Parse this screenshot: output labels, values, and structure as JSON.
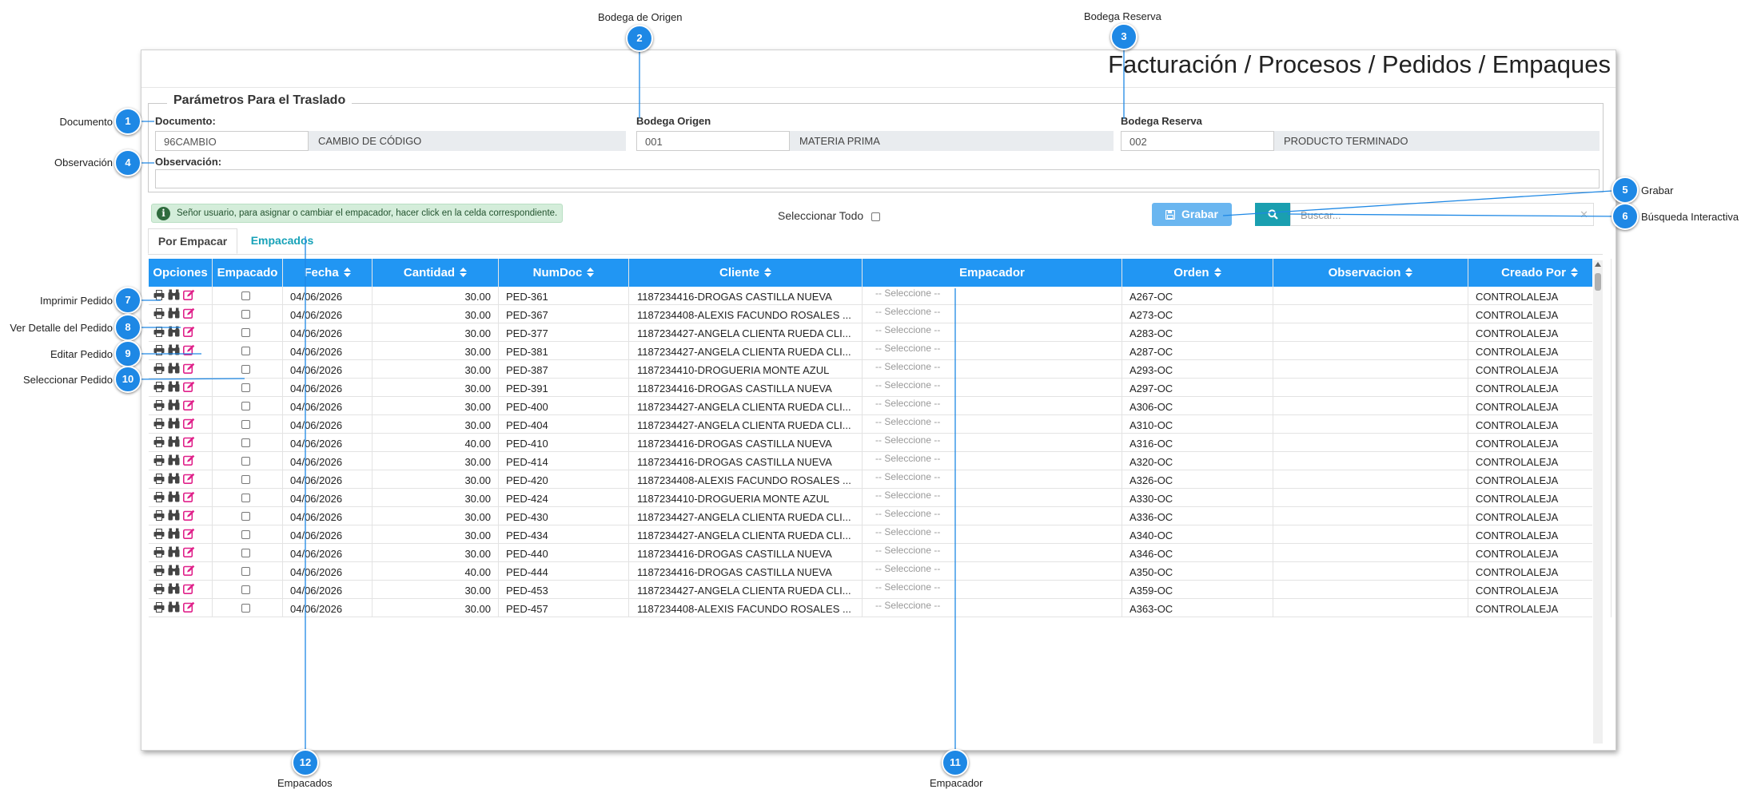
{
  "page_title": "Facturación / Procesos / Pedidos / Empaques",
  "params": {
    "legend": "Parámetros Para el Traslado",
    "documento_label": "Documento:",
    "documento_code": "96CAMBIO",
    "documento_desc": "CAMBIO DE CÓDIGO",
    "origen_label": "Bodega Origen",
    "origen_code": "001",
    "origen_desc": "MATERIA PRIMA",
    "reserva_label": "Bodega Reserva",
    "reserva_code": "002",
    "reserva_desc": "PRODUCTO TERMINADO",
    "observacion_label": "Observación:",
    "observacion_value": ""
  },
  "info_message": "Señor usuario, para asignar o cambiar el empacador, hacer click en la celda correspondiente.",
  "select_all_label": "Seleccionar Todo",
  "grabar_label": "Grabar",
  "search_placeholder": "Buscar...",
  "tabs": [
    {
      "label": "Por Empacar"
    },
    {
      "label": "Empacados"
    }
  ],
  "table": {
    "headers": [
      "Opciones",
      "Empacado",
      "Fecha",
      "Cantidad",
      "NumDoc",
      "Cliente",
      "Empacador",
      "Orden",
      "Observacion",
      "Creado Por"
    ],
    "empacador_placeholder": "-- Seleccione --",
    "rows": [
      {
        "fecha": "04/06/2026",
        "cantidad": "30.00",
        "numdoc": "PED-361",
        "cliente": "1187234416-DROGAS CASTILLA NUEVA",
        "orden": "A267-OC",
        "observacion": "",
        "creado": "CONTROLALEJA"
      },
      {
        "fecha": "04/06/2026",
        "cantidad": "30.00",
        "numdoc": "PED-367",
        "cliente": "1187234408-ALEXIS FACUNDO ROSALES ...",
        "orden": "A273-OC",
        "observacion": "",
        "creado": "CONTROLALEJA"
      },
      {
        "fecha": "04/06/2026",
        "cantidad": "30.00",
        "numdoc": "PED-377",
        "cliente": "1187234427-ANGELA CLIENTA RUEDA CLI...",
        "orden": "A283-OC",
        "observacion": "",
        "creado": "CONTROLALEJA"
      },
      {
        "fecha": "04/06/2026",
        "cantidad": "30.00",
        "numdoc": "PED-381",
        "cliente": "1187234427-ANGELA CLIENTA RUEDA CLI...",
        "orden": "A287-OC",
        "observacion": "",
        "creado": "CONTROLALEJA"
      },
      {
        "fecha": "04/06/2026",
        "cantidad": "30.00",
        "numdoc": "PED-387",
        "cliente": "1187234410-DROGUERIA MONTE AZUL",
        "orden": "A293-OC",
        "observacion": "",
        "creado": "CONTROLALEJA"
      },
      {
        "fecha": "04/06/2026",
        "cantidad": "30.00",
        "numdoc": "PED-391",
        "cliente": "1187234416-DROGAS CASTILLA NUEVA",
        "orden": "A297-OC",
        "observacion": "",
        "creado": "CONTROLALEJA"
      },
      {
        "fecha": "04/06/2026",
        "cantidad": "30.00",
        "numdoc": "PED-400",
        "cliente": "1187234427-ANGELA CLIENTA RUEDA CLI...",
        "orden": "A306-OC",
        "observacion": "",
        "creado": "CONTROLALEJA"
      },
      {
        "fecha": "04/06/2026",
        "cantidad": "30.00",
        "numdoc": "PED-404",
        "cliente": "1187234427-ANGELA CLIENTA RUEDA CLI...",
        "orden": "A310-OC",
        "observacion": "",
        "creado": "CONTROLALEJA"
      },
      {
        "fecha": "04/06/2026",
        "cantidad": "40.00",
        "numdoc": "PED-410",
        "cliente": "1187234416-DROGAS CASTILLA NUEVA",
        "orden": "A316-OC",
        "observacion": "",
        "creado": "CONTROLALEJA"
      },
      {
        "fecha": "04/06/2026",
        "cantidad": "30.00",
        "numdoc": "PED-414",
        "cliente": "1187234416-DROGAS CASTILLA NUEVA",
        "orden": "A320-OC",
        "observacion": "",
        "creado": "CONTROLALEJA"
      },
      {
        "fecha": "04/06/2026",
        "cantidad": "30.00",
        "numdoc": "PED-420",
        "cliente": "1187234408-ALEXIS FACUNDO ROSALES ...",
        "orden": "A326-OC",
        "observacion": "",
        "creado": "CONTROLALEJA"
      },
      {
        "fecha": "04/06/2026",
        "cantidad": "30.00",
        "numdoc": "PED-424",
        "cliente": "1187234410-DROGUERIA MONTE AZUL",
        "orden": "A330-OC",
        "observacion": "",
        "creado": "CONTROLALEJA"
      },
      {
        "fecha": "04/06/2026",
        "cantidad": "30.00",
        "numdoc": "PED-430",
        "cliente": "1187234427-ANGELA CLIENTA RUEDA CLI...",
        "orden": "A336-OC",
        "observacion": "",
        "creado": "CONTROLALEJA"
      },
      {
        "fecha": "04/06/2026",
        "cantidad": "30.00",
        "numdoc": "PED-434",
        "cliente": "1187234427-ANGELA CLIENTA RUEDA CLI...",
        "orden": "A340-OC",
        "observacion": "",
        "creado": "CONTROLALEJA"
      },
      {
        "fecha": "04/06/2026",
        "cantidad": "30.00",
        "numdoc": "PED-440",
        "cliente": "1187234416-DROGAS CASTILLA NUEVA",
        "orden": "A346-OC",
        "observacion": "",
        "creado": "CONTROLALEJA"
      },
      {
        "fecha": "04/06/2026",
        "cantidad": "40.00",
        "numdoc": "PED-444",
        "cliente": "1187234416-DROGAS CASTILLA NUEVA",
        "orden": "A350-OC",
        "observacion": "",
        "creado": "CONTROLALEJA"
      },
      {
        "fecha": "04/06/2026",
        "cantidad": "30.00",
        "numdoc": "PED-453",
        "cliente": "1187234427-ANGELA CLIENTA RUEDA CLI...",
        "orden": "A359-OC",
        "observacion": "",
        "creado": "CONTROLALEJA"
      },
      {
        "fecha": "04/06/2026",
        "cantidad": "30.00",
        "numdoc": "PED-457",
        "cliente": "1187234408-ALEXIS FACUNDO ROSALES ...",
        "orden": "A363-OC",
        "observacion": "",
        "creado": "CONTROLALEJA"
      }
    ]
  },
  "annotations": [
    {
      "num": "1",
      "label": "Documento"
    },
    {
      "num": "2",
      "label": "Bodega de Origen"
    },
    {
      "num": "3",
      "label": "Bodega Reserva"
    },
    {
      "num": "4",
      "label": "Observación"
    },
    {
      "num": "5",
      "label": "Grabar"
    },
    {
      "num": "6",
      "label": "Búsqueda Interactiva"
    },
    {
      "num": "7",
      "label": "Imprimir Pedido"
    },
    {
      "num": "8",
      "label": "Ver Detalle del Pedido"
    },
    {
      "num": "9",
      "label": "Editar Pedido"
    },
    {
      "num": "10",
      "label": "Seleccionar Pedido"
    },
    {
      "num": "11",
      "label": "Empacador"
    },
    {
      "num": "12",
      "label": "Empacados"
    }
  ],
  "colors": {
    "header_blue": "#2196f3",
    "badge_blue": "#1e88e5",
    "grabar": "#6ab6f0",
    "search_btn": "#1a9fb0",
    "info_bg": "#d4edda",
    "tab_link": "#17a2b8",
    "edit_icon": "#e0218a"
  },
  "icons": [
    "print-icon",
    "binoculars-icon",
    "edit-icon",
    "search-icon",
    "save-icon",
    "info-icon",
    "sort-icon",
    "clear-icon"
  ]
}
